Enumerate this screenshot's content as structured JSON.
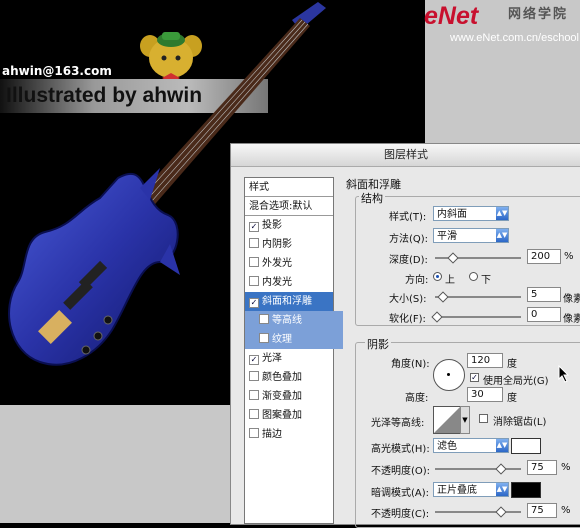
{
  "canvas": {
    "email": "ahwin@163.com",
    "banner_text": "Illustrated by ahwin",
    "logo": {
      "main": "eNet",
      "cn": "网络学院",
      "url": "www.eNet.com.cn/eschool"
    }
  },
  "dialog": {
    "title": "图层样式",
    "list_header": "样式",
    "list_blend": "混合选项:默认",
    "list_items": [
      {
        "label": "投影",
        "checked": true
      },
      {
        "label": "内阴影",
        "checked": false
      },
      {
        "label": "外发光",
        "checked": false
      },
      {
        "label": "内发光",
        "checked": false
      },
      {
        "label": "斜面和浮雕",
        "checked": true,
        "selected": true
      },
      {
        "label": "等高线",
        "checked": false,
        "sub": true
      },
      {
        "label": "纹理",
        "checked": false,
        "sub": true
      },
      {
        "label": "光泽",
        "checked": true
      },
      {
        "label": "颜色叠加",
        "checked": false
      },
      {
        "label": "渐变叠加",
        "checked": false
      },
      {
        "label": "图案叠加",
        "checked": false
      },
      {
        "label": "描边",
        "checked": false
      }
    ],
    "bevel": {
      "section_title": "斜面和浮雕",
      "structure_title": "结构",
      "style_label": "样式(T):",
      "style_value": "内斜面",
      "method_label": "方法(Q):",
      "method_value": "平滑",
      "depth_label": "深度(D):",
      "depth_value": "200",
      "depth_unit": "%",
      "direction_label": "方向:",
      "dir_up": "上",
      "dir_down": "下",
      "size_label": "大小(S):",
      "size_value": "5",
      "size_unit": "像素",
      "soften_label": "软化(F):",
      "soften_value": "0",
      "soften_unit": "像素"
    },
    "shading": {
      "title": "阴影",
      "angle_label": "角度(N):",
      "angle_value": "120",
      "angle_unit": "度",
      "global_light": "使用全局光(G)",
      "altitude_label": "高度:",
      "altitude_value": "30",
      "altitude_unit": "度",
      "gloss_label": "光泽等高线:",
      "antialias": "消除锯齿(L)",
      "highlight_label": "高光模式(H):",
      "highlight_value": "滤色",
      "highlight_color": "#ffffff",
      "opacity1_label": "不透明度(O):",
      "opacity1_value": "75",
      "opacity1_unit": "%",
      "shadow_label": "暗调模式(A):",
      "shadow_value": "正片叠底",
      "shadow_color": "#000000",
      "opacity2_label": "不透明度(C):",
      "opacity2_value": "75",
      "opacity2_unit": "%"
    }
  }
}
